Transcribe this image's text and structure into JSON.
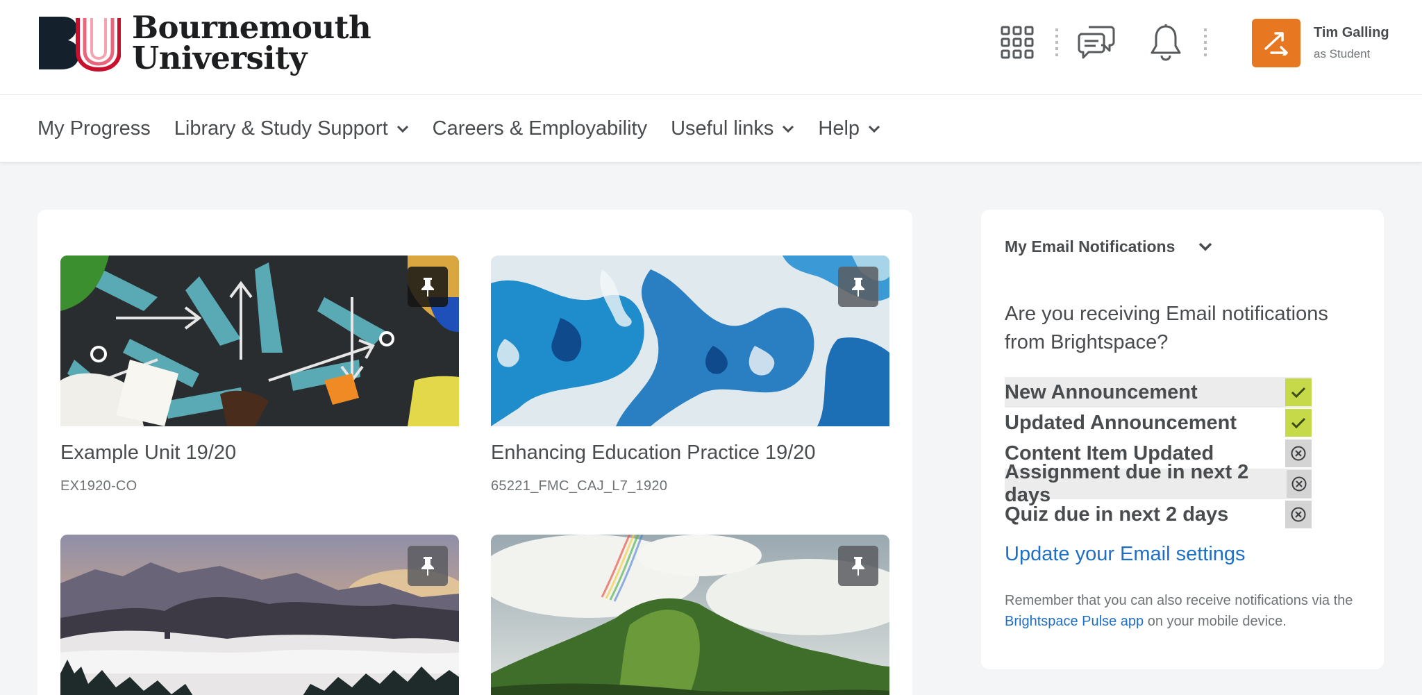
{
  "header": {
    "logo_line1": "Bournemouth",
    "logo_line2": "University",
    "logo_mark_text": "BU",
    "icons": [
      "app-grid-icon",
      "message-alerts-icon",
      "bell-icon"
    ],
    "user": {
      "name": "Tim Galling",
      "role": "as Student",
      "avatar_icon": "switch-arrows-icon"
    }
  },
  "nav": {
    "items": [
      {
        "label": "My Progress",
        "dropdown": false
      },
      {
        "label": "Library & Study Support",
        "dropdown": true
      },
      {
        "label": "Careers & Employability",
        "dropdown": false
      },
      {
        "label": "Useful links",
        "dropdown": true
      },
      {
        "label": "Help",
        "dropdown": true
      }
    ]
  },
  "courses": [
    {
      "title": "Example Unit 19/20",
      "code": "EX1920-CO",
      "image": "arrows-chalkboard"
    },
    {
      "title": "Enhancing Education Practice 19/20",
      "code": "65221_FMC_CAJ_L7_1920",
      "image": "blue-marble"
    },
    {
      "title": "",
      "code": "",
      "image": "misty-mountains-sunset"
    },
    {
      "title": "",
      "code": "",
      "image": "green-mountain-rainbow"
    }
  ],
  "notifications": {
    "heading": "My Email Notifications",
    "question": "Are you receiving Email notifications from Brightspace?",
    "items": [
      {
        "label": "New Announcement",
        "enabled": true
      },
      {
        "label": "Updated Announcement",
        "enabled": true
      },
      {
        "label": "Content Item Updated",
        "enabled": false
      },
      {
        "label": "Assignment due in next 2 days",
        "enabled": false
      },
      {
        "label": "Quiz due in next 2 days",
        "enabled": false
      }
    ],
    "settings_link": "Update your Email settings",
    "note_before": "Remember that you can also receive notifications via the ",
    "note_link": "Brightspace Pulse app",
    "note_after": " on your mobile device."
  },
  "colors": {
    "brand_red": "#c8102e",
    "brand_dark": "#1a2a3a",
    "avatar": "#e87722",
    "link": "#1f6fc5",
    "enabled": "#c6d948",
    "disabled": "#d4d4d4"
  }
}
